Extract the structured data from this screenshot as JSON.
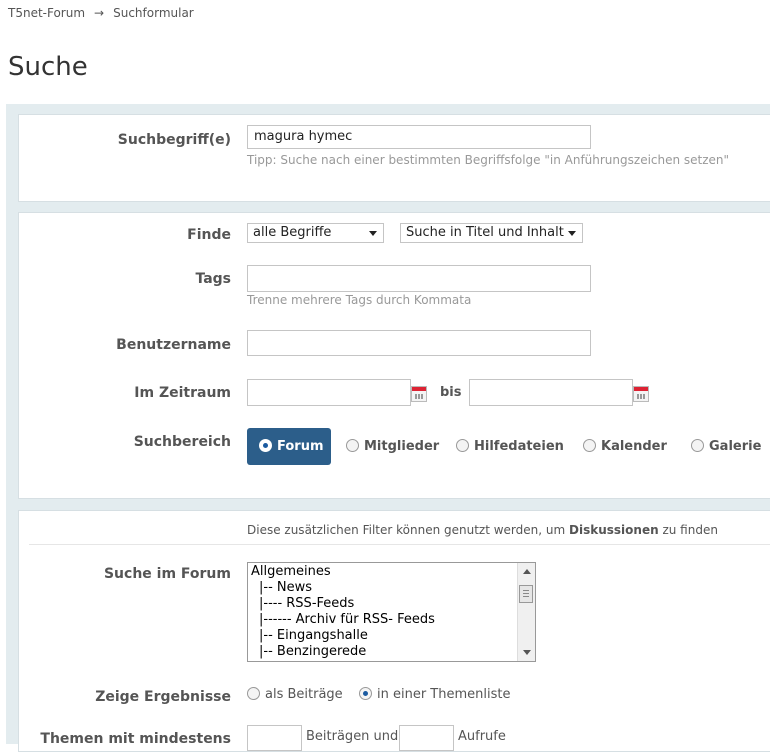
{
  "breadcrumb": {
    "items": [
      "T5net-Forum",
      "Suchformular"
    ],
    "separator": "→"
  },
  "page": {
    "title": "Suche"
  },
  "search_term": {
    "label": "Suchbegriff(e)",
    "value": "magura hymec",
    "hint": "Tipp: Suche nach einer bestimmten Begriffsfolge \"in Anführungszeichen setzen\""
  },
  "filters": {
    "find": {
      "label": "Finde",
      "mode_selected": "alle Begriffe",
      "scope_selected": "Suche in Titel und Inhalt"
    },
    "tags": {
      "label": "Tags",
      "value": "",
      "hint": "Trenne mehrere Tags durch Kommata"
    },
    "username": {
      "label": "Benutzername",
      "value": ""
    },
    "period": {
      "label": "Im Zeitraum",
      "from": "",
      "to": "",
      "between": "bis"
    },
    "area": {
      "label": "Suchbereich",
      "options": [
        "Forum",
        "Mitglieder",
        "Hilfedateien",
        "Kalender",
        "Galerie"
      ],
      "selected": "Forum"
    }
  },
  "forum_filters": {
    "intro_pre": "Diese zusätzlichen Filter können genutzt werden, um ",
    "intro_bold": "Diskussionen",
    "intro_post": " zu finden",
    "forum": {
      "label": "Suche im Forum",
      "items": [
        "Allgemeines",
        "  |-- News",
        "  |---- RSS-Feeds",
        "  |------ Archiv für RSS- Feeds",
        "  |-- Eingangshalle",
        "  |-- Benzingerede"
      ]
    },
    "results": {
      "label": "Zeige Ergebnisse",
      "options": [
        "als Beiträge",
        "in einer Themenliste"
      ],
      "selected": "in einer Themenliste"
    },
    "min": {
      "label": "Themen mit mindestens",
      "posts_label": "Beiträgen und",
      "views_label": "Aufrufe"
    }
  },
  "colors": {
    "accent": "#2c5e8a",
    "panel_bg": "#e3ecef",
    "hint": "#999999"
  }
}
